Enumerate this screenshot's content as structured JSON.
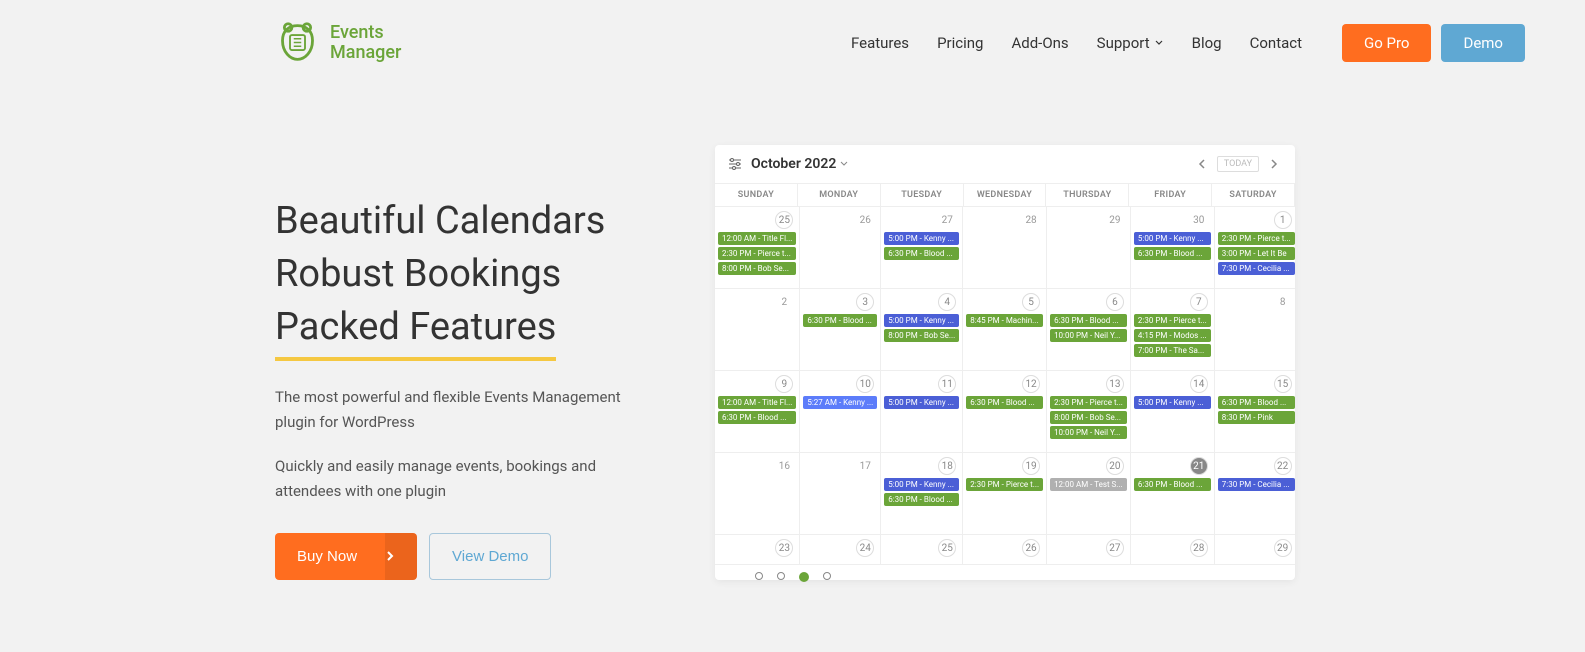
{
  "logo": {
    "line1": "Events",
    "line2": "Manager"
  },
  "nav": {
    "features": "Features",
    "pricing": "Pricing",
    "addons": "Add-Ons",
    "support": "Support",
    "blog": "Blog",
    "contact": "Contact",
    "gopro": "Go Pro",
    "demo": "Demo"
  },
  "hero": {
    "line1": "Beautiful Calendars",
    "line2": "Robust Bookings",
    "line3": "Packed Features",
    "desc1": "The most powerful and flexible Events Management plugin for WordPress",
    "desc2": "Quickly and easily manage events, bookings and attendees with one plugin",
    "buy": "Buy Now",
    "view_demo": "View Demo"
  },
  "calendar": {
    "title": "October 2022",
    "today": "TODAY",
    "days": [
      "SUNDAY",
      "MONDAY",
      "TUESDAY",
      "WEDNESDAY",
      "THURSDAY",
      "FRIDAY",
      "SATURDAY"
    ],
    "weeks": [
      [
        {
          "d": "25",
          "box": true,
          "events": [
            {
              "c": "green",
              "t": "12:00 AM - Title Fl..."
            },
            {
              "c": "green",
              "t": "2:30 PM - Pierce t..."
            },
            {
              "c": "green",
              "t": "8:00 PM - Bob Se..."
            }
          ]
        },
        {
          "d": "26",
          "events": []
        },
        {
          "d": "27",
          "events": [
            {
              "c": "blue",
              "t": "5:00 PM - Kenny ..."
            },
            {
              "c": "green",
              "t": "6:30 PM - Blood ..."
            }
          ]
        },
        {
          "d": "28",
          "events": []
        },
        {
          "d": "29",
          "events": []
        },
        {
          "d": "30",
          "events": [
            {
              "c": "blue",
              "t": "5:00 PM - Kenny ..."
            },
            {
              "c": "green",
              "t": "6:30 PM - Blood ..."
            }
          ]
        },
        {
          "d": "1",
          "box": true,
          "events": [
            {
              "c": "green",
              "t": "2:30 PM - Pierce t..."
            },
            {
              "c": "green",
              "t": "3:00 PM - Let It Be"
            },
            {
              "c": "blue",
              "t": "7:30 PM - Cecilia ..."
            }
          ]
        }
      ],
      [
        {
          "d": "2",
          "events": []
        },
        {
          "d": "3",
          "box": true,
          "events": [
            {
              "c": "green",
              "t": "6:30 PM - Blood ..."
            }
          ]
        },
        {
          "d": "4",
          "box": true,
          "events": [
            {
              "c": "blue",
              "t": "5:00 PM - Kenny ..."
            },
            {
              "c": "green",
              "t": "8:00 PM - Bob Se..."
            }
          ]
        },
        {
          "d": "5",
          "box": true,
          "events": [
            {
              "c": "green",
              "t": "8:45 PM - Machin..."
            }
          ]
        },
        {
          "d": "6",
          "box": true,
          "events": [
            {
              "c": "green",
              "t": "6:30 PM - Blood ..."
            },
            {
              "c": "green",
              "t": "10:00 PM - Neil Y..."
            }
          ]
        },
        {
          "d": "7",
          "box": true,
          "events": [
            {
              "c": "green",
              "t": "2:30 PM - Pierce t..."
            },
            {
              "c": "green",
              "t": "4:15 PM - Modos ..."
            },
            {
              "c": "green",
              "t": "7:00 PM - The Sa..."
            }
          ]
        },
        {
          "d": "8",
          "events": []
        }
      ],
      [
        {
          "d": "9",
          "box": true,
          "events": [
            {
              "c": "green",
              "t": "12:00 AM - Title Fl..."
            },
            {
              "c": "green",
              "t": "6:30 PM - Blood ..."
            }
          ]
        },
        {
          "d": "10",
          "box": true,
          "events": [
            {
              "c": "blue2",
              "t": "5:27 AM - Kenny ..."
            }
          ]
        },
        {
          "d": "11",
          "box": true,
          "events": [
            {
              "c": "blue",
              "t": "5:00 PM - Kenny ..."
            }
          ]
        },
        {
          "d": "12",
          "box": true,
          "events": [
            {
              "c": "green",
              "t": "6:30 PM - Blood ..."
            }
          ]
        },
        {
          "d": "13",
          "box": true,
          "events": [
            {
              "c": "green",
              "t": "2:30 PM - Pierce t..."
            },
            {
              "c": "green",
              "t": "8:00 PM - Bob Se..."
            },
            {
              "c": "green",
              "t": "10:00 PM - Neil Y..."
            }
          ]
        },
        {
          "d": "14",
          "box": true,
          "events": [
            {
              "c": "blue",
              "t": "5:00 PM - Kenny ..."
            }
          ]
        },
        {
          "d": "15",
          "box": true,
          "events": [
            {
              "c": "green",
              "t": "6:30 PM - Blood ..."
            },
            {
              "c": "green",
              "t": "8:30 PM - Pink"
            }
          ]
        }
      ],
      [
        {
          "d": "16",
          "events": []
        },
        {
          "d": "17",
          "events": []
        },
        {
          "d": "18",
          "box": true,
          "events": [
            {
              "c": "blue",
              "t": "5:00 PM - Kenny ..."
            },
            {
              "c": "green",
              "t": "6:30 PM - Blood ..."
            }
          ]
        },
        {
          "d": "19",
          "box": true,
          "events": [
            {
              "c": "green",
              "t": "2:30 PM - Pierce t..."
            }
          ]
        },
        {
          "d": "20",
          "box": true,
          "events": [
            {
              "c": "gray",
              "t": "12:00 AM - Test S..."
            }
          ]
        },
        {
          "d": "21",
          "box": true,
          "active": true,
          "events": [
            {
              "c": "green",
              "t": "6:30 PM - Blood ..."
            }
          ]
        },
        {
          "d": "22",
          "box": true,
          "events": [
            {
              "c": "blue",
              "t": "7:30 PM - Cecilia ..."
            }
          ]
        }
      ],
      [
        {
          "d": "23",
          "box": true,
          "events": []
        },
        {
          "d": "24",
          "box": true,
          "events": []
        },
        {
          "d": "25",
          "box": true,
          "events": []
        },
        {
          "d": "26",
          "box": true,
          "events": []
        },
        {
          "d": "27",
          "box": true,
          "events": []
        },
        {
          "d": "28",
          "box": true,
          "events": []
        },
        {
          "d": "29",
          "box": true,
          "events": []
        }
      ]
    ]
  }
}
